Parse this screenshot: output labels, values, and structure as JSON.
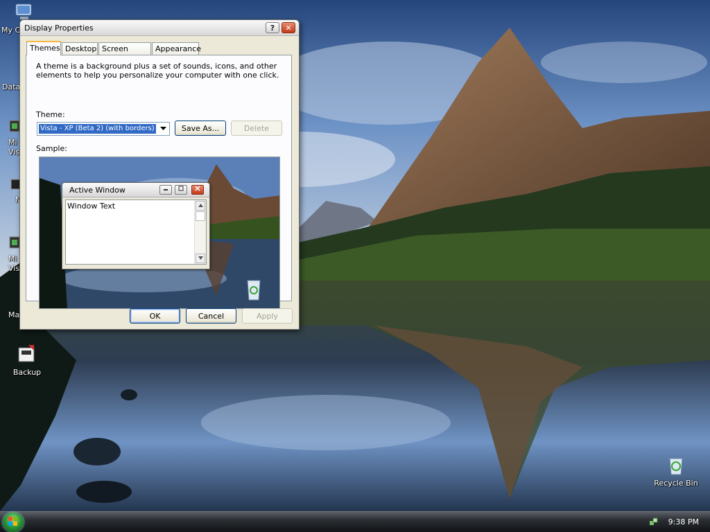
{
  "desktop": {
    "icons": [
      {
        "id": "my-computer",
        "label": "My C"
      },
      {
        "id": "data",
        "label": "Data"
      },
      {
        "id": "microsoft-visual-1",
        "label": "Mi\nVisu"
      },
      {
        "id": "n-item",
        "label": "N"
      },
      {
        "id": "microsoft-visual-2",
        "label": "Mi\nVisu"
      },
      {
        "id": "ma-item",
        "label": "Ma"
      },
      {
        "id": "backup",
        "label": "Backup"
      },
      {
        "id": "recycle-bin",
        "label": "Recycle Bin"
      }
    ]
  },
  "dialog": {
    "title": "Display Properties",
    "help_glyph": "?",
    "close_glyph": "✕",
    "tabs": [
      {
        "label": "Themes",
        "active": true
      },
      {
        "label": "Desktop",
        "active": false
      },
      {
        "label": "Screen Saver",
        "active": false
      },
      {
        "label": "Appearance",
        "active": false
      }
    ],
    "description": "A theme is a background plus a set of sounds, icons, and other elements to help you personalize your computer with one click.",
    "theme_label": "Theme:",
    "theme_value": "Vista - XP (Beta 2) (with borders)",
    "save_as_label": "Save As...",
    "delete_label": "Delete",
    "sample_label": "Sample:",
    "sample": {
      "window_title": "Active Window",
      "window_text": "Window Text"
    },
    "ok_label": "OK",
    "cancel_label": "Cancel",
    "apply_label": "Apply"
  },
  "taskbar": {
    "clock": "9:38 PM"
  },
  "colors": {
    "selection": "#316ac5",
    "close_button": "#c23a18",
    "dialog_face": "#ece9d8",
    "start_orb": "#2f9a3a"
  }
}
